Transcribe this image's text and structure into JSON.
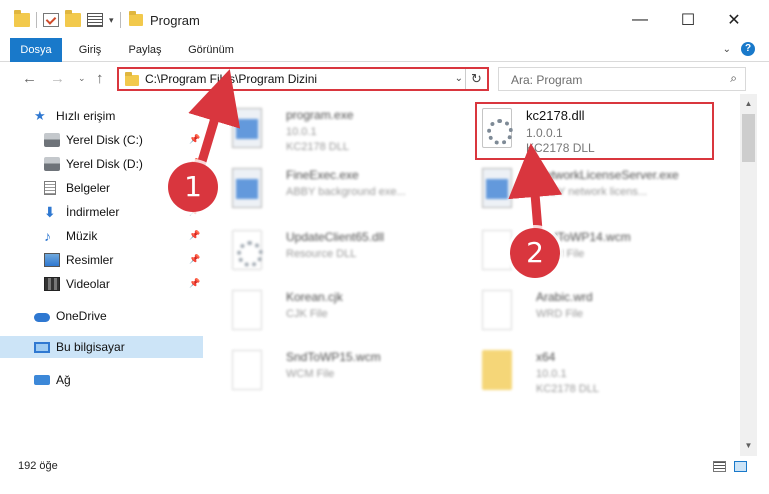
{
  "window": {
    "title": "Program",
    "minimize_glyph": "—",
    "maximize_glyph": "☐",
    "close_glyph": "✕"
  },
  "ribbon": {
    "tabs": [
      "Dosya",
      "Giriş",
      "Paylaş",
      "Görünüm"
    ],
    "active_tab": "Dosya",
    "accent_color": "#1979ca"
  },
  "address": {
    "path": "C:\\Program Files\\Program Dizini",
    "search_placeholder": "Ara: Program"
  },
  "sidebar": {
    "items": [
      {
        "label": "Hızlı erişim",
        "icon": "star-icon"
      },
      {
        "label": "Yerel Disk (C:)",
        "icon": "disk-icon",
        "pinned": true
      },
      {
        "label": "Yerel Disk (D:)",
        "icon": "disk-icon",
        "pinned": true
      },
      {
        "label": "Belgeler",
        "icon": "document-icon",
        "pinned": true
      },
      {
        "label": "İndirmeler",
        "icon": "download-icon",
        "pinned": true
      },
      {
        "label": "Müzik",
        "icon": "music-icon",
        "pinned": true
      },
      {
        "label": "Resimler",
        "icon": "pictures-icon",
        "pinned": true
      },
      {
        "label": "Videolar",
        "icon": "videos-icon",
        "pinned": true
      },
      {
        "label": "OneDrive",
        "icon": "cloud-icon"
      },
      {
        "label": "Bu bilgisayar",
        "icon": "computer-icon",
        "selected": true
      },
      {
        "label": "Ağ",
        "icon": "network-icon"
      }
    ]
  },
  "files": [
    {
      "name": "program.exe",
      "line2": "10.0.1",
      "line3": "KC2178 DLL",
      "icon": "program-icon",
      "blurred": true
    },
    {
      "name": "kc2178.dll",
      "line2": "1.0.0.1",
      "line3": "KC2178 DLL",
      "icon": "dll-gear-icon",
      "blurred": false
    },
    {
      "name": "FineExec.exe",
      "line2": "ABBY background exe...",
      "line3": "",
      "icon": "exe-icon",
      "blurred": true
    },
    {
      "name": "NetworkLicenseServer.exe",
      "line2": "ABBY network licens...",
      "line3": "",
      "icon": "exe-icon",
      "blurred": true
    },
    {
      "name": "UpdateClient65.dll",
      "line2": "Resource DLL",
      "line3": "",
      "icon": "dll-gear-icon",
      "blurred": true
    },
    {
      "name": "SndToWP14.wcm",
      "line2": "WCM File",
      "line3": "",
      "icon": "file-icon",
      "blurred": true
    },
    {
      "name": "Korean.cjk",
      "line2": "CJK File",
      "line3": "",
      "icon": "file-icon",
      "blurred": true
    },
    {
      "name": "Arabic.wrd",
      "line2": "WRD File",
      "line3": "",
      "icon": "file-icon",
      "blurred": true
    },
    {
      "name": "SndToWP15.wcm",
      "line2": "WCM File",
      "line3": "",
      "icon": "file-icon",
      "blurred": true
    },
    {
      "name": "x64",
      "line2": "10.0.1",
      "line3": "KC2178 DLL",
      "icon": "folder-zip-icon",
      "blurred": true
    }
  ],
  "status": {
    "item_count": "192 öğe"
  },
  "callouts": [
    {
      "number": "1"
    },
    {
      "number": "2"
    }
  ],
  "highlight_color": "#d9363e"
}
